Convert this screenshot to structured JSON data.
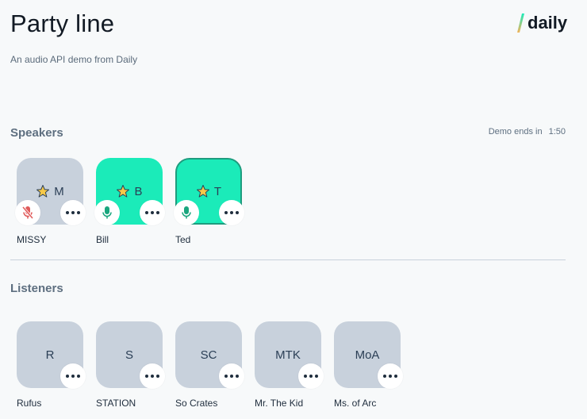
{
  "header": {
    "title": "Party line",
    "subtitle": "An audio API demo from Daily",
    "logo_text": "daily"
  },
  "speakers_section": {
    "title": "Speakers",
    "timer_label": "Demo ends in",
    "timer_value": "1:50",
    "participants": [
      {
        "initials": "M",
        "name": "MISSY",
        "moderator": true,
        "muted": true,
        "speaking": false
      },
      {
        "initials": "B",
        "name": "Bill",
        "moderator": true,
        "muted": false,
        "speaking": true
      },
      {
        "initials": "T",
        "name": "Ted",
        "moderator": true,
        "muted": false,
        "speaking": true,
        "active": true
      }
    ]
  },
  "listeners_section": {
    "title": "Listeners",
    "participants": [
      {
        "initials": "R",
        "name": "Rufus"
      },
      {
        "initials": "S",
        "name": "STATION"
      },
      {
        "initials": "SC",
        "name": "So Crates"
      },
      {
        "initials": "MTK",
        "name": "Mr. The Kid"
      },
      {
        "initials": "MoA",
        "name": "Ms. of Arc"
      }
    ]
  },
  "icons": {
    "star": "star-icon",
    "mic": "microphone-icon",
    "mic_muted": "microphone-muted-icon",
    "menu": "more-options-icon"
  },
  "colors": {
    "speaking_tile": "#1bebb9",
    "idle_tile": "#c8d1dc",
    "mic_active": "#1aa67e",
    "mic_muted": "#e05a5a",
    "star": "#f7c948"
  }
}
